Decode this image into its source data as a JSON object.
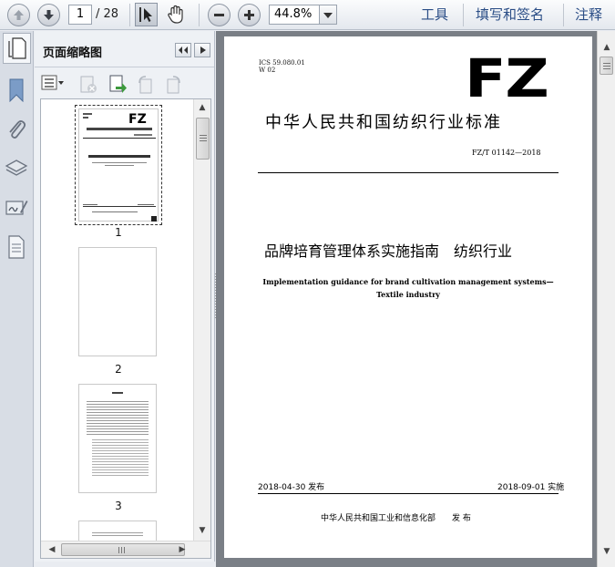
{
  "toolbar": {
    "current_page": "1",
    "page_total": "/ 28",
    "zoom": "44.8%",
    "tools": "工具",
    "fill_sign": "填写和签名",
    "comment": "注释"
  },
  "panel": {
    "title": "页面缩略图",
    "thumbnails": [
      {
        "label": "1"
      },
      {
        "label": "2"
      },
      {
        "label": "3"
      }
    ],
    "thumb1_logo": "FZ"
  },
  "document": {
    "ics": "ICS 59.080.01",
    "ccs": "W 02",
    "logo": "FZ",
    "standard_title": "中华人民共和国纺织行业标准",
    "standard_number": "FZ/T 01142—2018",
    "main_title": "品牌培育管理体系实施指南　纺织行业",
    "english_title_1": "Implementation guidance for brand cultivation management systems—",
    "english_title_2": "Textile industry",
    "issue_date": "2018-04-30 发布",
    "implement_date": "2018-09-01 实施",
    "publisher": "中华人民共和国工业和信息化部　　发 布"
  },
  "colors": {
    "link": "#2a4d86",
    "viewer_bg": "#7a7f86",
    "selection": "#3b4fa0"
  }
}
